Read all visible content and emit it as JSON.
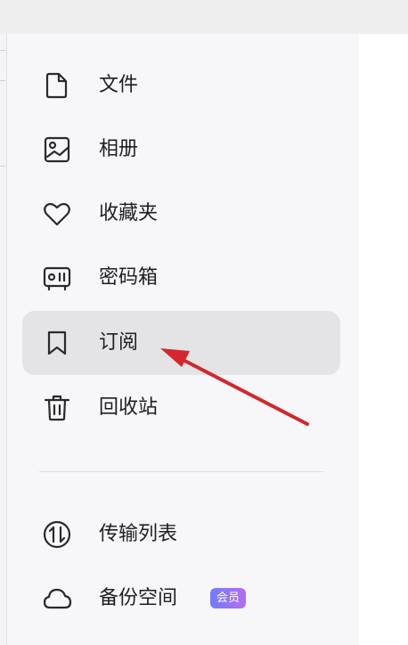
{
  "sidebar": {
    "items": [
      {
        "label": "文件",
        "icon": "file-icon"
      },
      {
        "label": "相册",
        "icon": "photo-album-icon"
      },
      {
        "label": "收藏夹",
        "icon": "heart-icon"
      },
      {
        "label": "密码箱",
        "icon": "safe-box-icon"
      },
      {
        "label": "订阅",
        "icon": "bookmark-icon",
        "active": true
      },
      {
        "label": "回收站",
        "icon": "trash-icon"
      },
      {
        "label": "传输列表",
        "icon": "transfer-icon"
      },
      {
        "label": "备份空间",
        "icon": "cloud-icon",
        "badge": "会员"
      }
    ]
  },
  "colors": {
    "sidebar_bg": "#f7f7f9",
    "active_item_bg": "#e4e4e6",
    "text": "#1f1f24",
    "icon_stroke": "#2a2a2e",
    "badge_gradient": [
      "#6f7bff",
      "#b56df2"
    ],
    "annotation_arrow": "#d4262c"
  }
}
